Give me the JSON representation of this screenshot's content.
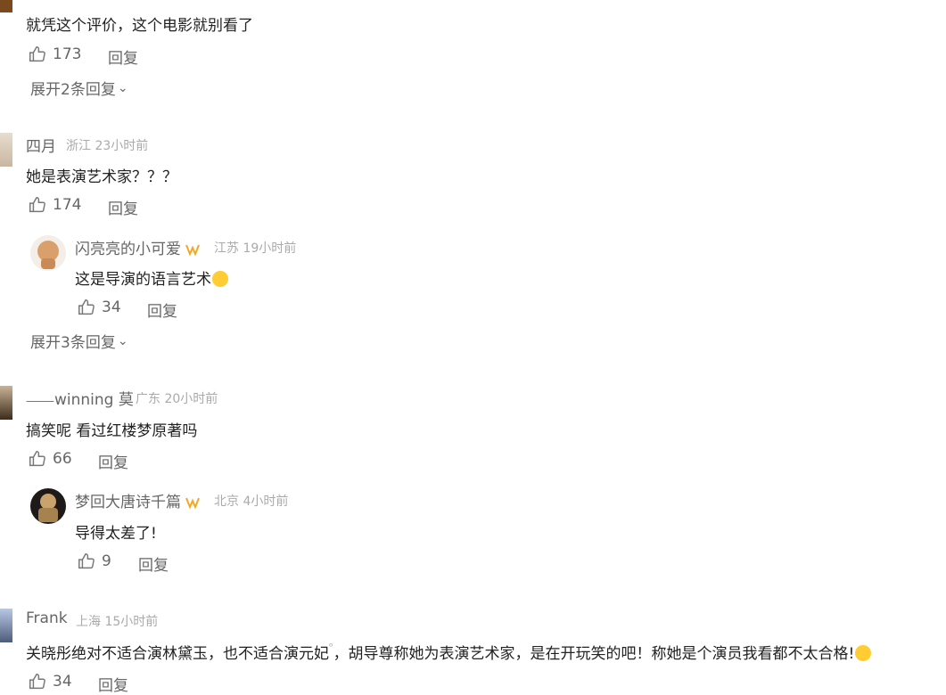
{
  "comments": [
    {
      "text": "就凭这个评价，这个电影就别看了",
      "likes": "173",
      "reply": "回复",
      "expand": "展开2条回复"
    },
    {
      "username": "四月",
      "location": "浙江",
      "time": "23小时前",
      "text": "她是表演艺术家？？？",
      "likes": "174",
      "reply": "回复",
      "sub": {
        "username": "闪亮亮的小可爱",
        "location": "江苏",
        "time": "19小时前",
        "text": "这是导演的语言艺术",
        "likes": "34",
        "reply": "回复"
      },
      "expand": "展开3条回复"
    },
    {
      "username_prefix": "winning 莫",
      "location": "广东",
      "time": "20小时前",
      "text": "搞笑呢 看过红楼梦原著吗",
      "likes": "66",
      "reply": "回复",
      "sub": {
        "username": "梦回大唐诗千篇",
        "location": "北京",
        "time": "4小时前",
        "text": "导得太差了!",
        "likes": "9",
        "reply": "回复"
      }
    },
    {
      "username": "Frank",
      "location": "上海",
      "time": "15小时前",
      "text": "关晓彤绝对不适合演林黛玉，也不适合演元妃",
      "text2": "，胡导尊称她为表演艺术家，是在开玩笑的吧！称她是个演员我看都不太合格!",
      "likes": "34",
      "reply": "回复"
    }
  ],
  "colors": {
    "badge": "#f5a623",
    "emoji": "#ffcc33"
  }
}
